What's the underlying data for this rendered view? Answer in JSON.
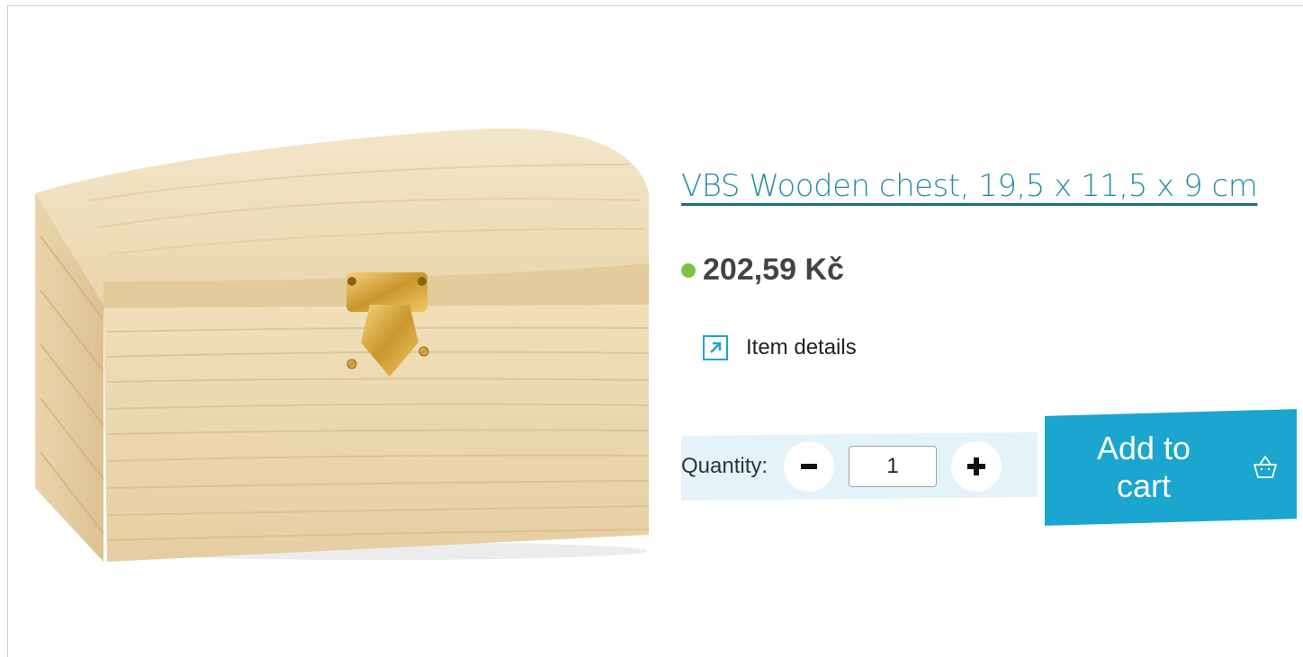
{
  "product": {
    "title": "VBS Wooden chest, 19,5 x 11,5 x 9 cm",
    "price": "202,59 Kč",
    "image_alt": "Wooden chest with brass clasp"
  },
  "details_link": {
    "label": "Item details",
    "icon": "external-arrow-icon"
  },
  "quantity": {
    "label": "Quantity:",
    "value": "1",
    "decrease_icon": "minus-icon",
    "increase_icon": "plus-icon"
  },
  "cart": {
    "label": "Add to cart",
    "icon": "basket-icon"
  },
  "colors": {
    "accent": "#1aa6cf",
    "title": "#2a8fa8",
    "stock_dot": "#7bc144",
    "qty_bar": "#e3f3f9"
  }
}
